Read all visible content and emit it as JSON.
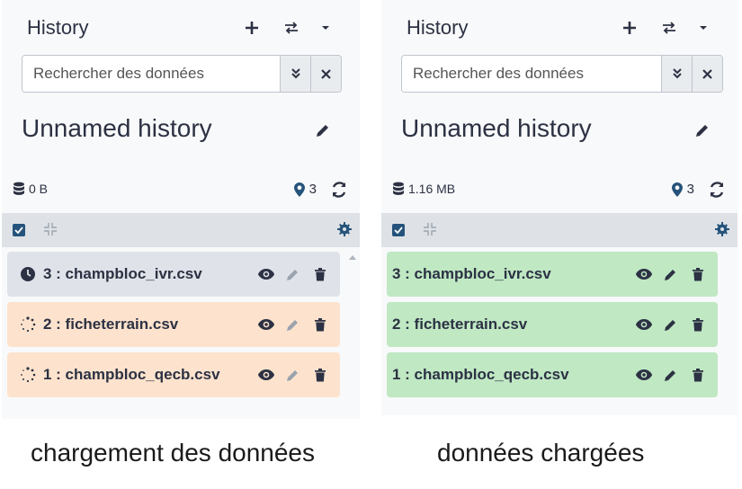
{
  "colors": {
    "text": "#2c3143",
    "queued": "#dfe3e9",
    "running": "#fde3cd",
    "ok": "#bfe8c3",
    "toolbar": "#dee2e6",
    "panel": "#f8f9fa"
  },
  "panels": [
    {
      "header": {
        "title": "History",
        "icons": [
          "plus-icon",
          "exchange-icon",
          "caret-down-icon"
        ]
      },
      "search": {
        "placeholder": "Rechercher des données",
        "value": ""
      },
      "history_name": "Unnamed history",
      "stats": {
        "size": "0 B",
        "count": "3"
      },
      "datasets": [
        {
          "label": "3 : champbloc_ivr.csv",
          "state": "queued",
          "state_icon": "clock-icon"
        },
        {
          "label": "2 : ficheterrain.csv",
          "state": "running",
          "state_icon": "spinner-icon"
        },
        {
          "label": "1 : champbloc_qecb.csv",
          "state": "running",
          "state_icon": "spinner-icon"
        }
      ],
      "caption": "chargement des données"
    },
    {
      "header": {
        "title": "History",
        "icons": [
          "plus-icon",
          "exchange-icon",
          "caret-down-icon"
        ]
      },
      "search": {
        "placeholder": "Rechercher des données",
        "value": ""
      },
      "history_name": "Unnamed history",
      "stats": {
        "size": "1.16 MB",
        "count": "3"
      },
      "datasets": [
        {
          "label": "3 : champbloc_ivr.csv",
          "state": "ok",
          "state_icon": ""
        },
        {
          "label": "2 : ficheterrain.csv",
          "state": "ok",
          "state_icon": ""
        },
        {
          "label": "1 : champbloc_qecb.csv",
          "state": "ok",
          "state_icon": ""
        }
      ],
      "caption": "données chargées"
    }
  ]
}
